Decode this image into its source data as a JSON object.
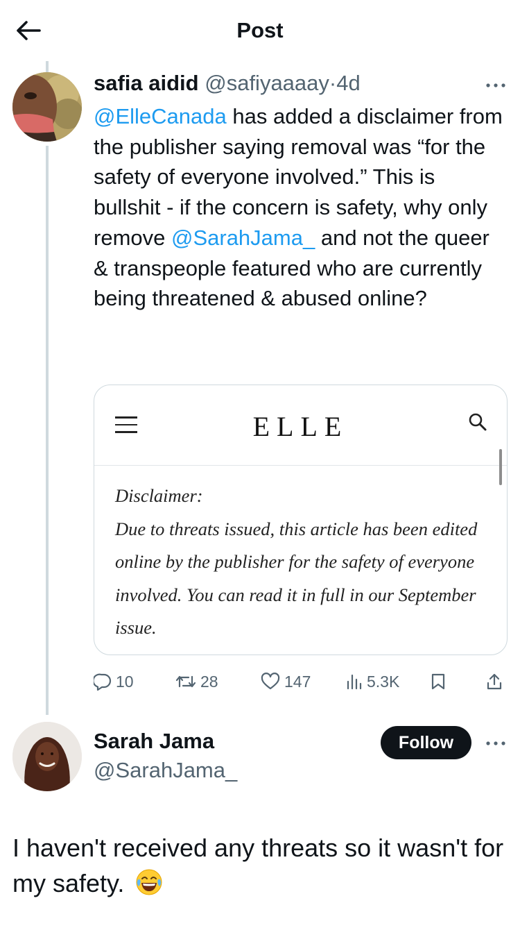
{
  "header": {
    "title": "Post"
  },
  "tweet1": {
    "author_name": "safia aidid",
    "author_handle": "@safiyaaaay",
    "separator": "·",
    "time": "4d",
    "body": {
      "mention1": "@ElleCanada",
      "text1": " has added a disclaimer from the publisher saying removal was “for the safety of everyone involved.” This is bullshit - if the concern is safety, why only remove ",
      "mention2": "@SarahJama_",
      "text2": " and not the queer & transpeople featured who are currently being threatened & abused online?"
    },
    "card": {
      "logo": "ELLE",
      "disclaimer_title": "Disclaimer:",
      "disclaimer_text": "Due to threats issued, this article has been edited online by the publisher for the safety of everyone involved. You can read it in full in our September issue."
    },
    "metrics": {
      "replies": "10",
      "reposts": "28",
      "likes": "147",
      "views": "5.3K"
    }
  },
  "tweet2": {
    "author_name": "Sarah Jama",
    "author_handle": "@SarahJama_",
    "follow_label": "Follow",
    "body": "I haven't received any threats so it wasn't for my safety.",
    "emoji": "face-with-tears-of-joy"
  },
  "icons": [
    "back-arrow-icon",
    "more-icon",
    "reply-icon",
    "repost-icon",
    "like-icon",
    "views-icon",
    "bookmark-icon",
    "share-icon",
    "hamburger-menu-icon",
    "search-icon"
  ],
  "colors": {
    "link": "#1d9bf0",
    "secondary": "#536471",
    "border": "#cfd9de",
    "button": "#0f1419"
  }
}
